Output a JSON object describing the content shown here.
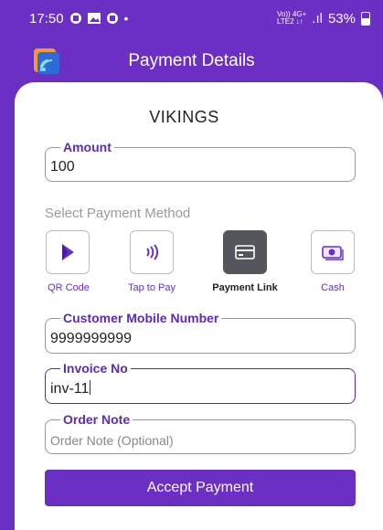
{
  "status_bar": {
    "time": "17:50",
    "network_top": "Vo)) 4G+",
    "network_bottom": "LTE2 ↓↑",
    "signal": ".ıl",
    "battery": "53%"
  },
  "app_bar": {
    "title": "Payment Details",
    "logo_icon": "nfc-logo-icon"
  },
  "merchant_name": "VIKINGS",
  "amount_field": {
    "label": "Amount",
    "value": "100"
  },
  "payment_method": {
    "section_label": "Select Payment Method",
    "options": [
      {
        "label": "QR Code",
        "icon": "qr-code-icon",
        "selected": false
      },
      {
        "label": "Tap to Pay",
        "icon": "contactless-icon",
        "selected": false
      },
      {
        "label": "Payment Link",
        "icon": "card-icon",
        "selected": true
      },
      {
        "label": "Cash",
        "icon": "cash-icon",
        "selected": false
      }
    ]
  },
  "customer_mobile_field": {
    "label": "Customer Mobile Number",
    "value": "9999999999"
  },
  "invoice_field": {
    "label": "Invoice No",
    "value": "inv-11"
  },
  "order_note_field": {
    "label": "Order Note",
    "placeholder": "Order Note (Optional)"
  },
  "accept_button": {
    "label": "Accept Payment"
  },
  "colors": {
    "primary": "#6b2fc4",
    "selected_method": "#55565c",
    "label_purple": "#5b2bb8"
  }
}
